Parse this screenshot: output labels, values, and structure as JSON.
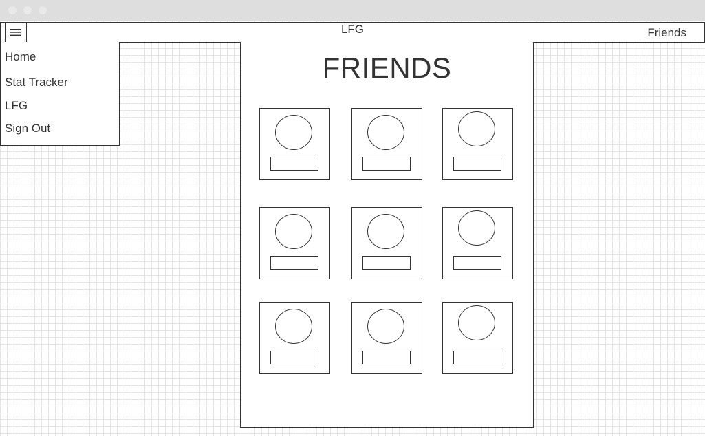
{
  "navbar": {
    "title": "LFG",
    "right_link": "Friends"
  },
  "side_menu": {
    "items": [
      {
        "label": "Home"
      },
      {
        "label": "Stat Tracker"
      },
      {
        "label": "LFG"
      },
      {
        "label": "Sign Out"
      }
    ]
  },
  "page": {
    "title": "FRIENDS"
  },
  "friends": {
    "count": 9
  },
  "icons": {
    "menu": "hamburger-icon",
    "avatar": "avatar-placeholder-icon"
  }
}
